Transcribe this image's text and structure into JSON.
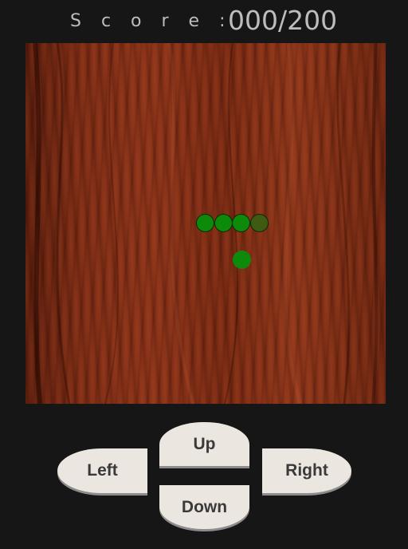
{
  "score": {
    "label": "S c o r e :",
    "value": "000/200"
  },
  "board": {
    "snake": [
      {
        "role": "body",
        "color": "#0e8a0a"
      },
      {
        "role": "body",
        "color": "#0e8a0a"
      },
      {
        "role": "body",
        "color": "#0e8a0a"
      },
      {
        "role": "head",
        "color": "#3f5a12"
      }
    ],
    "food_color": "#0e8a0a",
    "texture": "wood"
  },
  "controls": {
    "up_label": "Up",
    "down_label": "Down",
    "left_label": "Left",
    "right_label": "Right"
  }
}
